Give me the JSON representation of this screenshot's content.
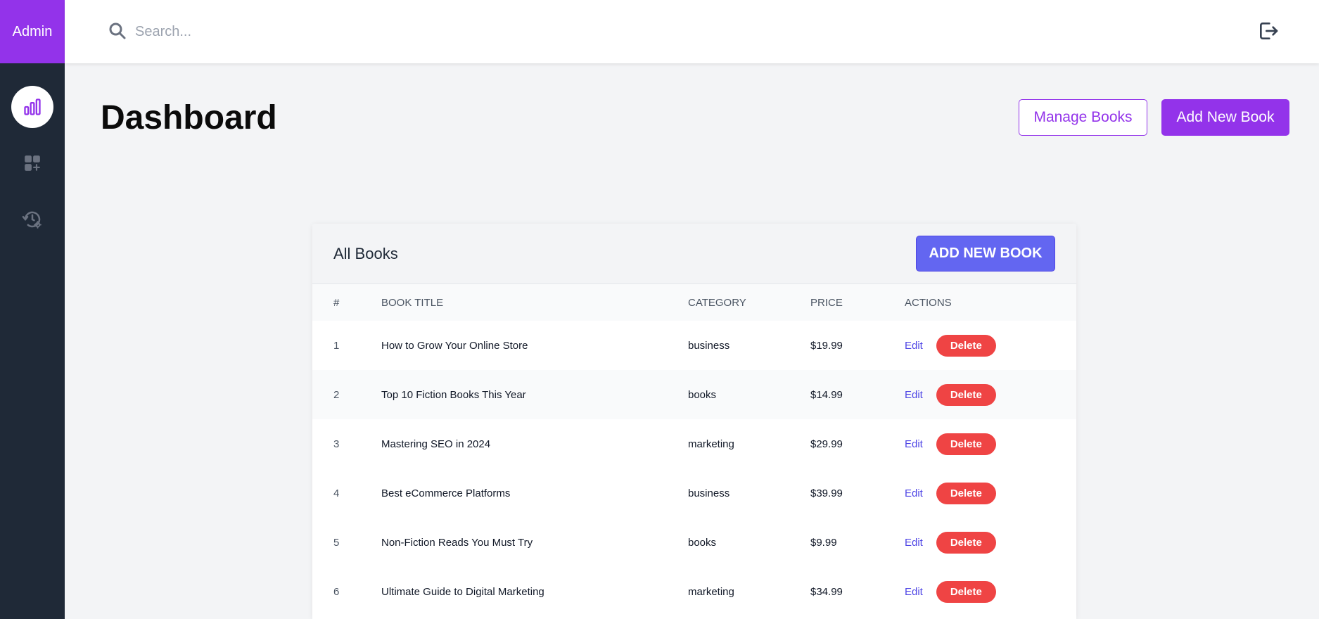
{
  "sidebar": {
    "brand": "Admin",
    "items": [
      {
        "icon": "bar-chart-icon",
        "active": true
      },
      {
        "icon": "apps-add-icon",
        "active": false
      },
      {
        "icon": "history-settings-icon",
        "active": false
      }
    ]
  },
  "topbar": {
    "search_placeholder": "Search...",
    "search_icon": "search-icon",
    "logout_icon": "logout-icon"
  },
  "header": {
    "title": "Dashboard",
    "manage_label": "Manage Books",
    "add_label": "Add New Book"
  },
  "table": {
    "title": "All Books",
    "add_button": "ADD NEW BOOK",
    "columns": [
      "#",
      "BOOK TITLE",
      "CATEGORY",
      "PRICE",
      "ACTIONS"
    ],
    "edit_label": "Edit",
    "delete_label": "Delete",
    "rows": [
      {
        "num": "1",
        "title": "How to Grow Your Online Store",
        "category": "business",
        "price": "$19.99"
      },
      {
        "num": "2",
        "title": "Top 10 Fiction Books This Year",
        "category": "books",
        "price": "$14.99"
      },
      {
        "num": "3",
        "title": "Mastering SEO in 2024",
        "category": "marketing",
        "price": "$29.99"
      },
      {
        "num": "4",
        "title": "Best eCommerce Platforms",
        "category": "business",
        "price": "$39.99"
      },
      {
        "num": "5",
        "title": "Non-Fiction Reads You Must Try",
        "category": "books",
        "price": "$9.99"
      },
      {
        "num": "6",
        "title": "Ultimate Guide to Digital Marketing",
        "category": "marketing",
        "price": "$34.99"
      }
    ]
  },
  "colors": {
    "brand": "#9333ea",
    "sidebar_bg": "#1f2937",
    "indigo": "#6366f1",
    "danger": "#ef4444"
  }
}
